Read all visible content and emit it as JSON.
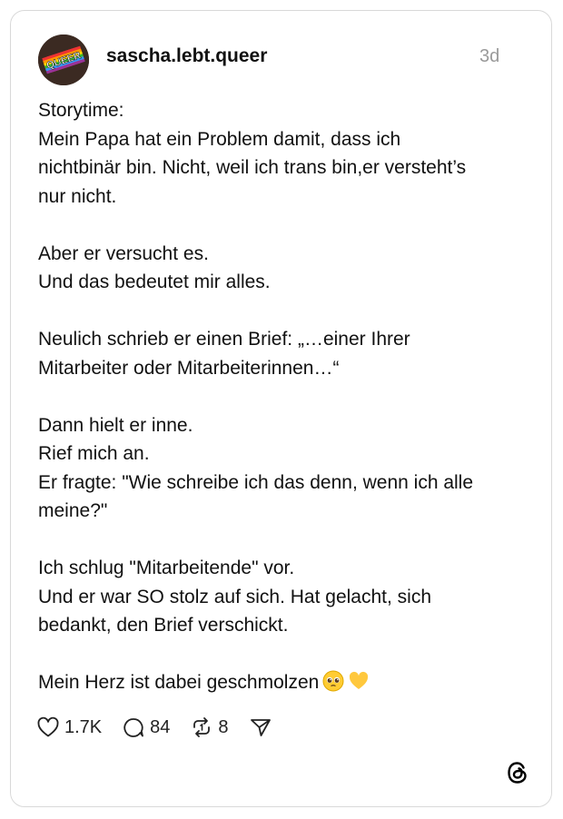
{
  "post": {
    "username": "sascha.lebt.queer",
    "time_ago": "3d",
    "avatar_text": "QUEER",
    "paragraphs": [
      [
        "Storytime:",
        "Mein Papa hat ein Problem damit, dass ich",
        "nichtbinär bin. Nicht, weil ich trans bin,er versteht’s",
        "nur nicht."
      ],
      [
        "Aber er versucht es.",
        "Und das bedeutet mir alles."
      ],
      [
        "Neulich schrieb er einen Brief: „…einer Ihrer",
        "Mitarbeiter oder Mitarbeiterinnen…“"
      ],
      [
        "Dann hielt er inne.",
        "Rief mich an.",
        "Er fragte: \"Wie schreibe ich das denn, wenn ich alle",
        "meine?\""
      ],
      [
        "Ich schlug \"Mitarbeitende\" vor.",
        "Und er war SO stolz auf sich. Hat gelacht, sich",
        "bedankt, den Brief verschickt."
      ]
    ],
    "last_line": "Mein Herz ist dabei geschmolzen",
    "emojis": [
      "pleading-face",
      "yellow-heart"
    ]
  },
  "actions": {
    "likes": "1.7K",
    "replies": "84",
    "reposts": "8",
    "icons": [
      "heart-icon",
      "comment-icon",
      "repost-icon",
      "share-icon"
    ]
  },
  "branding": {
    "logo": "threads-logo"
  }
}
